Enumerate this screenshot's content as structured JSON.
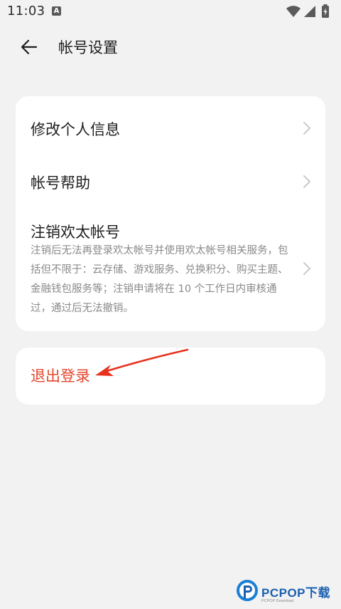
{
  "status_bar": {
    "time": "11:03",
    "notification_badge": "A",
    "icons": [
      "wifi-icon",
      "cellular-signal-icon",
      "battery-icon"
    ]
  },
  "header": {
    "title": "帐号设置",
    "back_icon": "arrow-left-icon"
  },
  "settings": {
    "items": [
      {
        "title": "修改个人信息"
      },
      {
        "title": "帐号帮助"
      },
      {
        "title": "注销欢太帐号",
        "description": "注销后无法再登录欢太帐号并使用欢太帐号相关服务，包括但不限于：云存储、游戏服务、兑换积分、购买主题、金融钱包服务等；注销申请将在 10 个工作日内审核通过，通过后无法撤销。"
      }
    ]
  },
  "logout": {
    "label": "退出登录"
  },
  "watermark": {
    "brand": "PCPOP下载",
    "sub": "PCPOP Download"
  },
  "colors": {
    "background": "#f2f2f2",
    "card": "#ffffff",
    "logout_text": "#e4462d",
    "annotation_arrow": "#e8321e",
    "watermark_blue": "#1a5fb0"
  }
}
